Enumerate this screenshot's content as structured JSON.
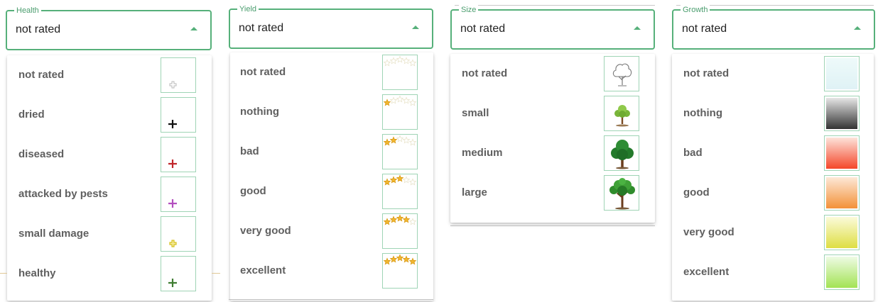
{
  "panels": [
    {
      "legend": "Health",
      "value": "not rated",
      "options": [
        {
          "label": "not rated",
          "icon": "plus-outline-icon",
          "color": "#b8b8b8"
        },
        {
          "label": "dried",
          "icon": "plus-icon",
          "color": "#111111"
        },
        {
          "label": "diseased",
          "icon": "plus-icon",
          "color": "#c0262b"
        },
        {
          "label": "attacked by pests",
          "icon": "plus-icon",
          "color": "#b34fbf"
        },
        {
          "label": "small damage",
          "icon": "plus-outline-icon",
          "color": "#d6c11f"
        },
        {
          "label": "healthy",
          "icon": "plus-icon",
          "color": "#3f7d32"
        }
      ]
    },
    {
      "legend": "Yield",
      "value": "not rated",
      "options": [
        {
          "label": "not rated",
          "icon": "stars-icon",
          "stars": 0
        },
        {
          "label": "nothing",
          "icon": "stars-icon",
          "stars": 1
        },
        {
          "label": "bad",
          "icon": "stars-icon",
          "stars": 2
        },
        {
          "label": "good",
          "icon": "stars-icon",
          "stars": 3
        },
        {
          "label": "very good",
          "icon": "stars-icon",
          "stars": 4
        },
        {
          "label": "excellent",
          "icon": "stars-icon",
          "stars": 5
        }
      ]
    },
    {
      "legend": "Size",
      "value": "not rated",
      "options": [
        {
          "label": "not rated",
          "icon": "tree-outline-icon"
        },
        {
          "label": "small",
          "icon": "small-tree-icon"
        },
        {
          "label": "medium",
          "icon": "medium-tree-icon"
        },
        {
          "label": "large",
          "icon": "large-tree-icon"
        }
      ]
    },
    {
      "legend": "Growth",
      "value": "not rated",
      "options": [
        {
          "label": "not rated",
          "icon": "gradient-swatch-icon",
          "top": "#eefafa",
          "bottom": "#dff2f5"
        },
        {
          "label": "nothing",
          "icon": "gradient-swatch-icon",
          "top": "#e6e6e6",
          "bottom": "#333333"
        },
        {
          "label": "bad",
          "icon": "gradient-swatch-icon",
          "top": "#fde3da",
          "bottom": "#f4472a"
        },
        {
          "label": "good",
          "icon": "gradient-swatch-icon",
          "top": "#fde8d7",
          "bottom": "#f39138"
        },
        {
          "label": "very good",
          "icon": "gradient-swatch-icon",
          "top": "#fbfbda",
          "bottom": "#dede43"
        },
        {
          "label": "excellent",
          "icon": "gradient-swatch-icon",
          "top": "#eefbe4",
          "bottom": "#a3e354"
        }
      ]
    }
  ],
  "colors": {
    "accent": "#56b07a",
    "star": "#f2b731",
    "star_empty": "#e9e4cc"
  }
}
